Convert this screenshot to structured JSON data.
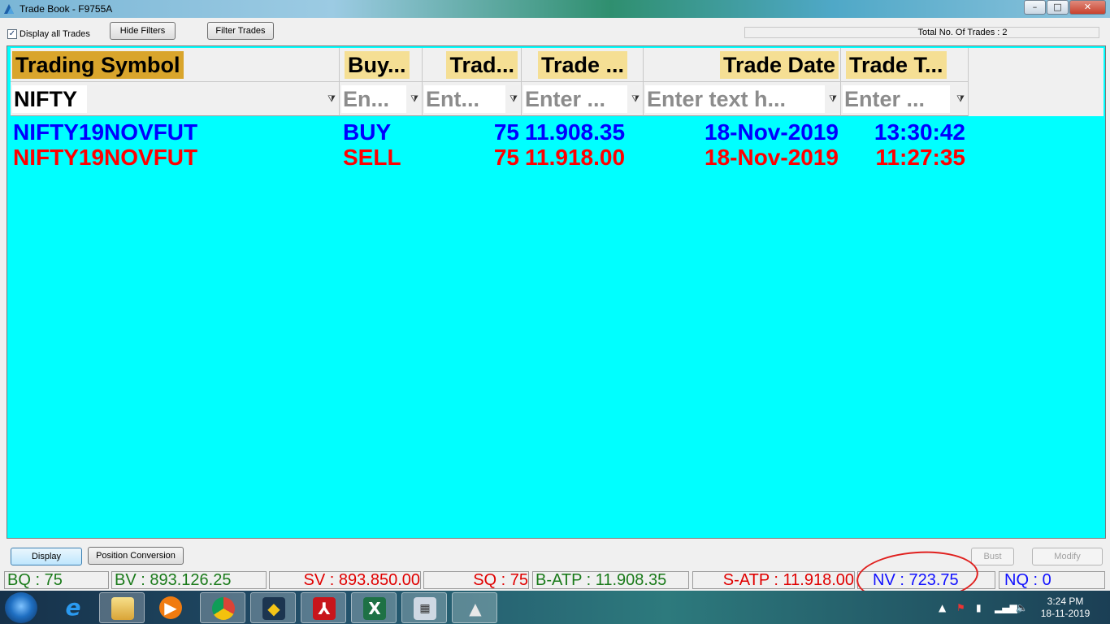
{
  "window": {
    "title": "Trade Book - F9755A",
    "minimize": "–",
    "maximize": "□",
    "close": "✕"
  },
  "toolbar": {
    "display_all_label": "Display all Trades",
    "display_all_checked": "✓",
    "hide_filters_label": "Hide Filters",
    "filter_trades_label": "Filter Trades",
    "total_trades": "Total No. Of Trades : 2"
  },
  "grid": {
    "columns": [
      "Trading Symbol",
      "Buy...",
      "Trad...",
      "Trade ...",
      "Trade Date",
      "Trade T..."
    ],
    "filters": [
      "NIFTY",
      "En...",
      "Ent...",
      "Enter ...",
      "Enter text h...",
      "Enter ..."
    ],
    "rows": [
      {
        "symbol": "NIFTY19NOVFUT",
        "side": "BUY",
        "qty": "75",
        "price": "11.908.35",
        "date": "18-Nov-2019",
        "time": "13:30:42"
      },
      {
        "symbol": "NIFTY19NOVFUT",
        "side": "SELL",
        "qty": "75",
        "price": "11.918.00",
        "date": "18-Nov-2019",
        "time": "11:27:35"
      }
    ],
    "background_color": "#00ffff",
    "buy_color": "#0000ff",
    "sell_color": "#ff0000"
  },
  "actions": {
    "display_label": "Display",
    "position_conversion_label": "Position Conversion",
    "bust_label": "Bust",
    "modify_label": "Modify"
  },
  "status": {
    "bq": "BQ : 75",
    "bv": "BV : 893.126.25",
    "sv": "SV : 893.850.00",
    "sq": "SQ : 75",
    "batp": "B-ATP : 11.908.35",
    "satp": "S-ATP : 11.918.00",
    "nv": "NV : 723.75",
    "nq": "NQ : 0"
  },
  "taskbar": {
    "items": [
      "windows-start",
      "internet-explorer",
      "file-explorer",
      "media-player",
      "chrome",
      "trading-terminal",
      "pdf-reader",
      "excel",
      "calculator",
      "prism-app"
    ],
    "time": "3:24 PM",
    "date": "18-11-2019"
  }
}
